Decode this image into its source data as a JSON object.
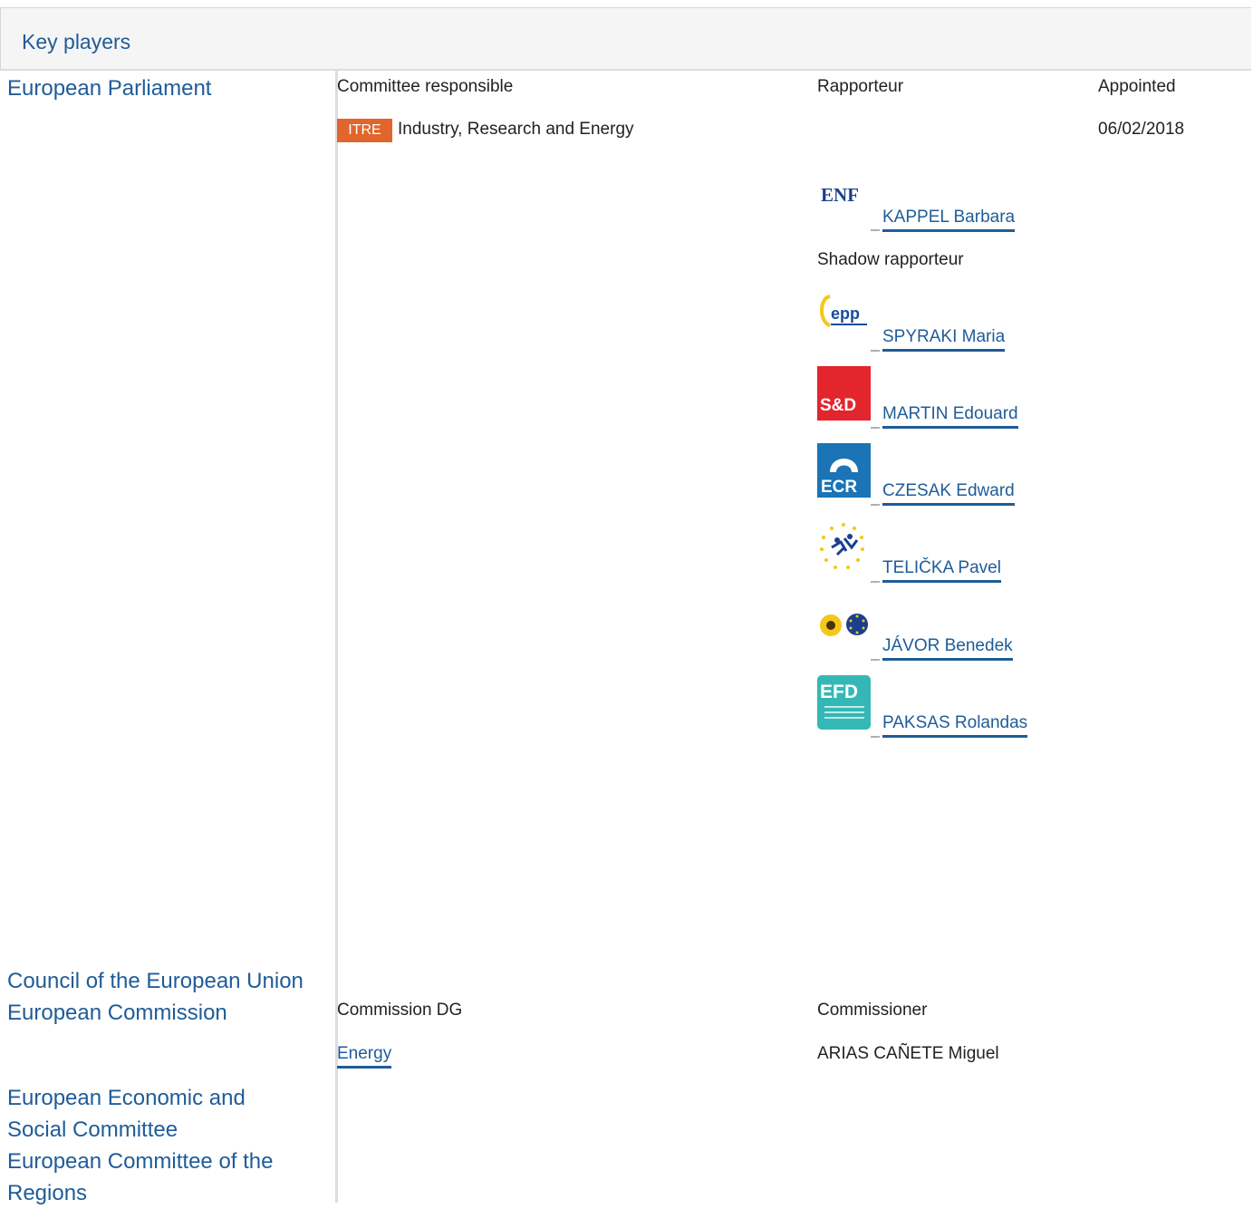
{
  "header": {
    "title": "Key players"
  },
  "institutions": {
    "parliament": "European Parliament",
    "council": "Council of the European Union",
    "commission": "European Commission",
    "eesc_line1": "European Economic and",
    "eesc_line2": "Social Committee",
    "cor_line1": "European Committee of the",
    "cor_line2": "Regions"
  },
  "parliament": {
    "col_committee": "Committee responsible",
    "col_rapporteur": "Rapporteur",
    "col_appointed": "Appointed",
    "committee_code": "ITRE",
    "committee_name": "Industry, Research and Energy",
    "appointed_date": "06/02/2018",
    "rapporteur": {
      "name": "KAPPEL Barbara",
      "group_logo": "enf-logo"
    },
    "shadow_label": "Shadow rapporteur",
    "shadows": [
      {
        "name": "SPYRAKI Maria",
        "group_logo": "epp-logo"
      },
      {
        "name": "MARTIN Edouard",
        "group_logo": "sd-logo"
      },
      {
        "name": "CZESAK Edward",
        "group_logo": "ecr-logo"
      },
      {
        "name": "TELIČKA Pavel",
        "group_logo": "alde-logo"
      },
      {
        "name": "JÁVOR Benedek",
        "group_logo": "greens-efa-logo"
      },
      {
        "name": "PAKSAS Rolandas",
        "group_logo": "efdd-logo"
      }
    ]
  },
  "commission": {
    "col_dg": "Commission DG",
    "col_commissioner": "Commissioner",
    "dg": "Energy",
    "commissioner": "ARIAS CAÑETE Miguel"
  },
  "logo_text": {
    "enf": "ENF",
    "epp": "epp",
    "sd": "S&D",
    "ecr": "ECR",
    "efd": "EFD"
  },
  "colors": {
    "link": "#1f5c99",
    "badge": "#e0662d",
    "sd": "#e3252d",
    "ecr": "#1a74b5",
    "efd": "#35b8b5"
  }
}
